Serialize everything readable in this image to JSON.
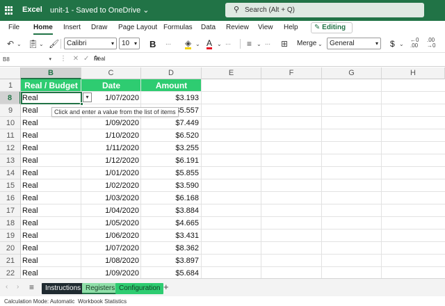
{
  "app": {
    "name": "Excel",
    "file_title": "unit-1 - Saved to OneDrive",
    "title_caret": "⌄"
  },
  "search": {
    "placeholder": "Search (Alt + Q)",
    "icon": "search-icon"
  },
  "menu": {
    "items": [
      "File",
      "Home",
      "Insert",
      "Draw",
      "Page Layout",
      "Formulas",
      "Data",
      "Review",
      "View",
      "Help"
    ],
    "active": "Home",
    "editing_label": "Editing"
  },
  "toolbar": {
    "font_name": "Calibri",
    "font_size": "10",
    "bold": "B",
    "font_color_letter": "A",
    "merge_label": "Merge",
    "number_format": "General",
    "currency": "$"
  },
  "formula_bar": {
    "name_box": "B8",
    "fx": "fx",
    "value": "Real"
  },
  "columns": [
    "B",
    "C",
    "D",
    "E",
    "F",
    "G",
    "H"
  ],
  "selected_column": "B",
  "rows": [
    "1",
    "8",
    "9",
    "10",
    "11",
    "12",
    "13",
    "14",
    "15",
    "16",
    "17",
    "18",
    "19",
    "20",
    "21",
    "22"
  ],
  "selected_row": "8",
  "table": {
    "headers": [
      "Real / Budget",
      "Date",
      "Amount"
    ],
    "rows": [
      [
        "Real",
        "1/07/2020",
        "$3.193"
      ],
      [
        "Real",
        "",
        "$5.557"
      ],
      [
        "Real",
        "1/09/2020",
        "$7.449"
      ],
      [
        "Real",
        "1/10/2020",
        "$6.520"
      ],
      [
        "Real",
        "1/11/2020",
        "$3.255"
      ],
      [
        "Real",
        "1/12/2020",
        "$6.191"
      ],
      [
        "Real",
        "1/01/2020",
        "$5.855"
      ],
      [
        "Real",
        "1/02/2020",
        "$3.590"
      ],
      [
        "Real",
        "1/03/2020",
        "$6.168"
      ],
      [
        "Real",
        "1/04/2020",
        "$3.884"
      ],
      [
        "Real",
        "1/05/2020",
        "$4.665"
      ],
      [
        "Real",
        "1/06/2020",
        "$3.431"
      ],
      [
        "Real",
        "1/07/2020",
        "$8.362"
      ],
      [
        "Real",
        "1/08/2020",
        "$3.897"
      ],
      [
        "Real",
        "1/09/2020",
        "$5.684"
      ]
    ]
  },
  "tooltip": "Click and enter a value from the list of items",
  "sheets": [
    {
      "name": "Instructions",
      "bg": "#1f2a30",
      "fg": "#ffffff"
    },
    {
      "name": "Registers",
      "bg": "#8fdfa8",
      "fg": "#1a3a25"
    },
    {
      "name": "Configuration",
      "bg": "#2ecc71",
      "fg": "#0f3b22"
    }
  ],
  "status": {
    "calc_mode": "Calculation Mode: Automatic",
    "workbook_stats": "Workbook Statistics"
  },
  "colors": {
    "brand": "#217346",
    "header_green": "#2ecc71"
  }
}
